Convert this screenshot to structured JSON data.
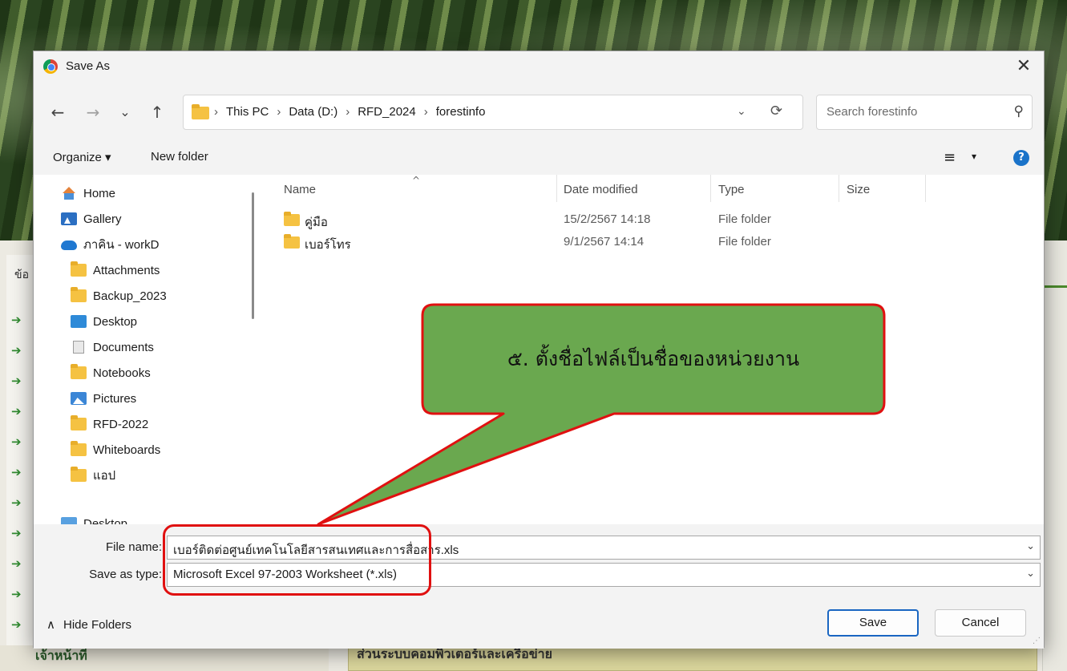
{
  "background": {
    "sidebar_label": "ข้อ",
    "arrow_glyph": "➔",
    "bottom_left_text": "เจ้าหน้าที่",
    "bottom_yellow_text": "ส่วนระบบคอมพิวเตอร์และเครือข่าย"
  },
  "dialog": {
    "title": "Save As",
    "close_glyph": "✕"
  },
  "nav": {
    "back": "←",
    "forward": "→",
    "recent": "⌄",
    "up": "↑",
    "breadcrumb": [
      "This PC",
      "Data (D:)",
      "RFD_2024",
      "forestinfo"
    ],
    "separator": "›",
    "address_dropdown": "⌄",
    "refresh": "⟳",
    "search_placeholder": "Search forestinfo",
    "search_icon": "⚲"
  },
  "toolbar": {
    "organize": "Organize ▾",
    "new_folder": "New folder",
    "view_icon": "≡",
    "view_chevron": "▾",
    "help": "?"
  },
  "sidebar": {
    "items": [
      {
        "label": "Home",
        "icon": "home-icon"
      },
      {
        "label": "Gallery",
        "icon": "gallery-icon"
      },
      {
        "label": "ภาคิน - workD",
        "icon": "cloud-icon"
      },
      {
        "label": "Attachments",
        "icon": "folder-icon"
      },
      {
        "label": "Backup_2023",
        "icon": "folder-icon"
      },
      {
        "label": "Desktop",
        "icon": "desktop-icon"
      },
      {
        "label": "Documents",
        "icon": "documents-icon"
      },
      {
        "label": "Notebooks",
        "icon": "folder-icon"
      },
      {
        "label": "Pictures",
        "icon": "pictures-icon"
      },
      {
        "label": "RFD-2022",
        "icon": "folder-icon"
      },
      {
        "label": "Whiteboards",
        "icon": "folder-icon"
      },
      {
        "label": "แอป",
        "icon": "folder-icon"
      },
      {
        "label": "Desktop",
        "icon": "desktop-icon"
      }
    ]
  },
  "filelist": {
    "columns": [
      "Name",
      "Date modified",
      "Type",
      "Size"
    ],
    "rows": [
      {
        "name": "คู่มือ",
        "date": "15/2/2567 14:18",
        "type": "File folder",
        "size": ""
      },
      {
        "name": "เบอร์โทร",
        "date": "9/1/2567 14:14",
        "type": "File folder",
        "size": ""
      }
    ]
  },
  "form": {
    "file_name_label": "File name:",
    "file_name_value": "เบอร์ติดต่อศูนย์เทคโนโลยีสารสนเทศและการสื่อสาร.xls",
    "save_type_label": "Save as type:",
    "save_type_value": "Microsoft Excel 97-2003 Worksheet (*.xls)",
    "dropdown_chevron": "⌄"
  },
  "footer": {
    "hide_folders": "Hide Folders",
    "hide_glyph": "∧",
    "save": "Save",
    "cancel": "Cancel"
  },
  "annotation": {
    "callout_text": "๕. ตั้งชื่อไฟล์เป็นชื่อของหน่วยงาน",
    "callout_fill": "#6aa84f",
    "callout_border": "#e01010"
  }
}
